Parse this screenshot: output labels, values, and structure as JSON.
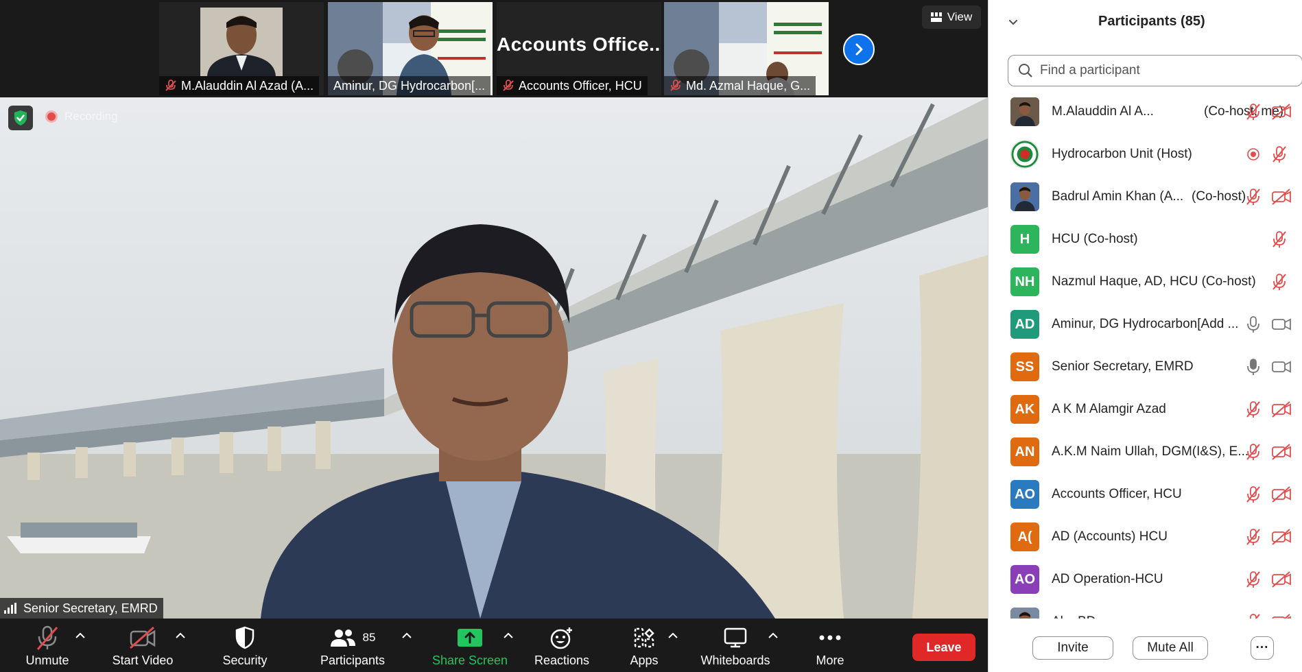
{
  "thumbnails": [
    {
      "name": "M.Alauddin Al Azad (A...",
      "muted": true
    },
    {
      "name": "Aminur, DG Hydrocarbon[...",
      "muted": false
    },
    {
      "name": "Accounts Officer, HCU",
      "muted": true,
      "big_text": "Accounts  Office..."
    },
    {
      "name": "Md. Azmal Haque,   G...",
      "muted": true
    }
  ],
  "view_label": "View",
  "main_video": {
    "recording_label": "Recording",
    "speaker_name": "Senior Secretary, EMRD"
  },
  "toolbar": {
    "unmute": "Unmute",
    "start_video": "Start Video",
    "security": "Security",
    "participants": "Participants",
    "participants_count": "85",
    "share_screen": "Share Screen",
    "reactions": "Reactions",
    "apps": "Apps",
    "whiteboards": "Whiteboards",
    "more": "More",
    "leave": "Leave"
  },
  "panel": {
    "title": "Participants (85)",
    "search_placeholder": "Find a participant",
    "participants": [
      {
        "avatar_text": "",
        "avatar_color": "#6b5a4a",
        "name": "M.Alauddin Al A...",
        "role": "(Co-host, me)",
        "mic": "muted",
        "video": "off",
        "photo": true
      },
      {
        "avatar_text": "",
        "avatar_color": "#ffffff",
        "name": "Hydrocarbon Unit (Host)",
        "role": "",
        "mic": "recording",
        "video": "muted-mic",
        "emblem": true
      },
      {
        "avatar_text": "",
        "avatar_color": "#4a6fa5",
        "name": "Badrul Amin Khan (A...",
        "role": "(Co-host)",
        "mic": "muted",
        "video": "off",
        "photo": true
      },
      {
        "avatar_text": "H",
        "avatar_color": "#2cb55a",
        "name": "HCU (Co-host)",
        "role": "",
        "mic": "none",
        "video": "muted-mic"
      },
      {
        "avatar_text": "NH",
        "avatar_color": "#2cb55a",
        "name": "Nazmul Haque, AD, HCU (Co-host)",
        "role": "",
        "mic": "none",
        "video": "muted-mic"
      },
      {
        "avatar_text": "AD",
        "avatar_color": "#1f9a7a",
        "name": "Aminur, DG Hydrocarbon[Add ...",
        "role": "",
        "mic": "on",
        "video": "on"
      },
      {
        "avatar_text": "SS",
        "avatar_color": "#e06a10",
        "name": "Senior Secretary, EMRD",
        "role": "",
        "mic": "on-active",
        "video": "on"
      },
      {
        "avatar_text": "AK",
        "avatar_color": "#e06a10",
        "name": "A K M Alamgir Azad",
        "role": "",
        "mic": "muted",
        "video": "off"
      },
      {
        "avatar_text": "AN",
        "avatar_color": "#e06a10",
        "name": "A.K.M Naim Ullah, DGM(I&S), E...",
        "role": "",
        "mic": "muted",
        "video": "off"
      },
      {
        "avatar_text": "AO",
        "avatar_color": "#2a7ac0",
        "name": "Accounts Officer, HCU",
        "role": "",
        "mic": "muted",
        "video": "off"
      },
      {
        "avatar_text": "A(",
        "avatar_color": "#e06a10",
        "name": "AD (Accounts) HCU",
        "role": "",
        "mic": "muted",
        "video": "off"
      },
      {
        "avatar_text": "AO",
        "avatar_color": "#8a3fb8",
        "name": "AD Operation-HCU",
        "role": "",
        "mic": "muted",
        "video": "off"
      },
      {
        "avatar_text": "",
        "avatar_color": "#7a8aa0",
        "name": "Al... BD",
        "role": "",
        "mic": "muted",
        "video": "off",
        "photo": true
      }
    ],
    "invite_label": "Invite",
    "mute_all_label": "Mute All",
    "more_label": "···"
  }
}
